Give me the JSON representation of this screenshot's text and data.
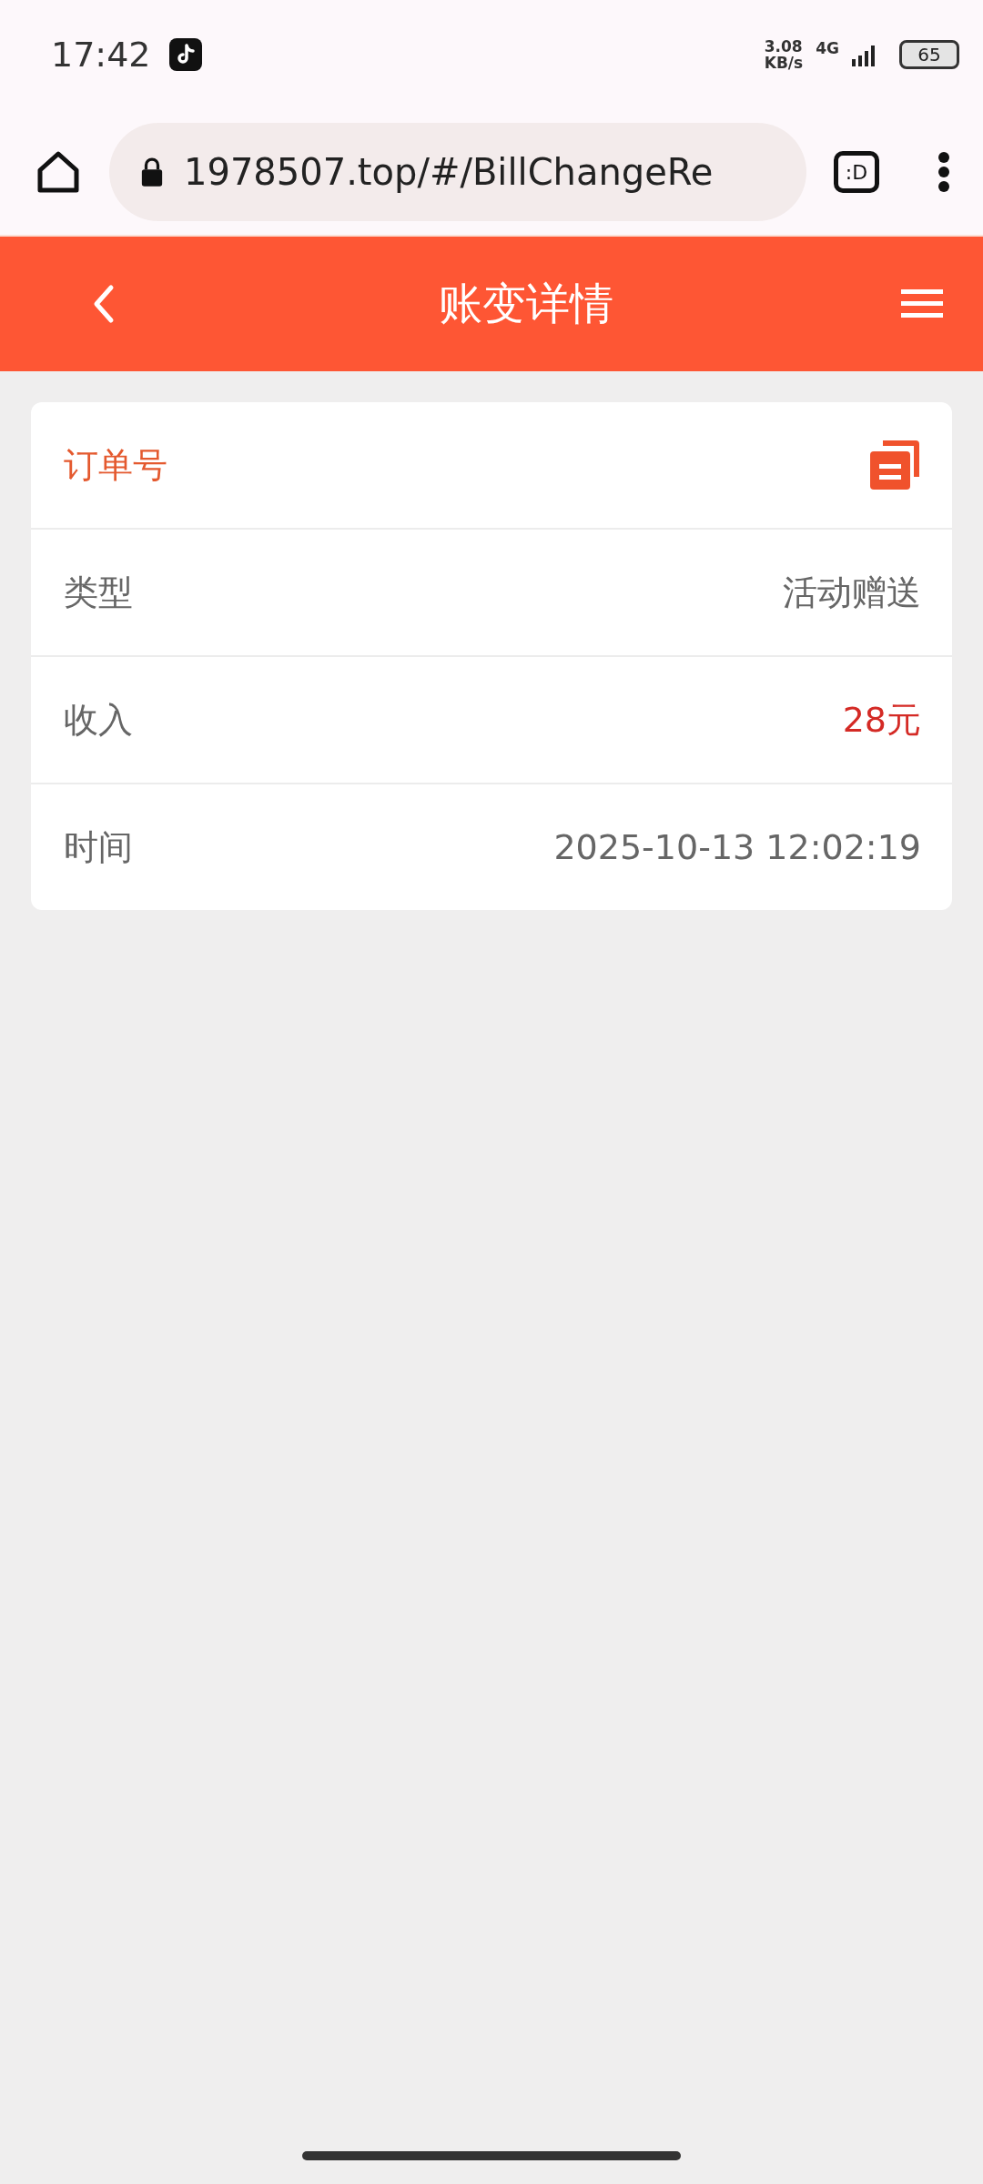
{
  "status_bar": {
    "time": "17:42",
    "net_speed": "3.08",
    "net_unit": "KB/s",
    "network": "4G",
    "battery": "65"
  },
  "browser": {
    "url": "1978507.top/#/BillChangeRe",
    "tab_button": ":D"
  },
  "header": {
    "title": "账变详情"
  },
  "rows": [
    {
      "kind": "copy",
      "label": "订单号"
    },
    {
      "kind": "text",
      "label": "类型",
      "value": "活动赠送"
    },
    {
      "kind": "amount",
      "label": "收入",
      "value": "28元"
    },
    {
      "kind": "text",
      "label": "时间",
      "value": "2025-10-13 12:02:19"
    }
  ]
}
